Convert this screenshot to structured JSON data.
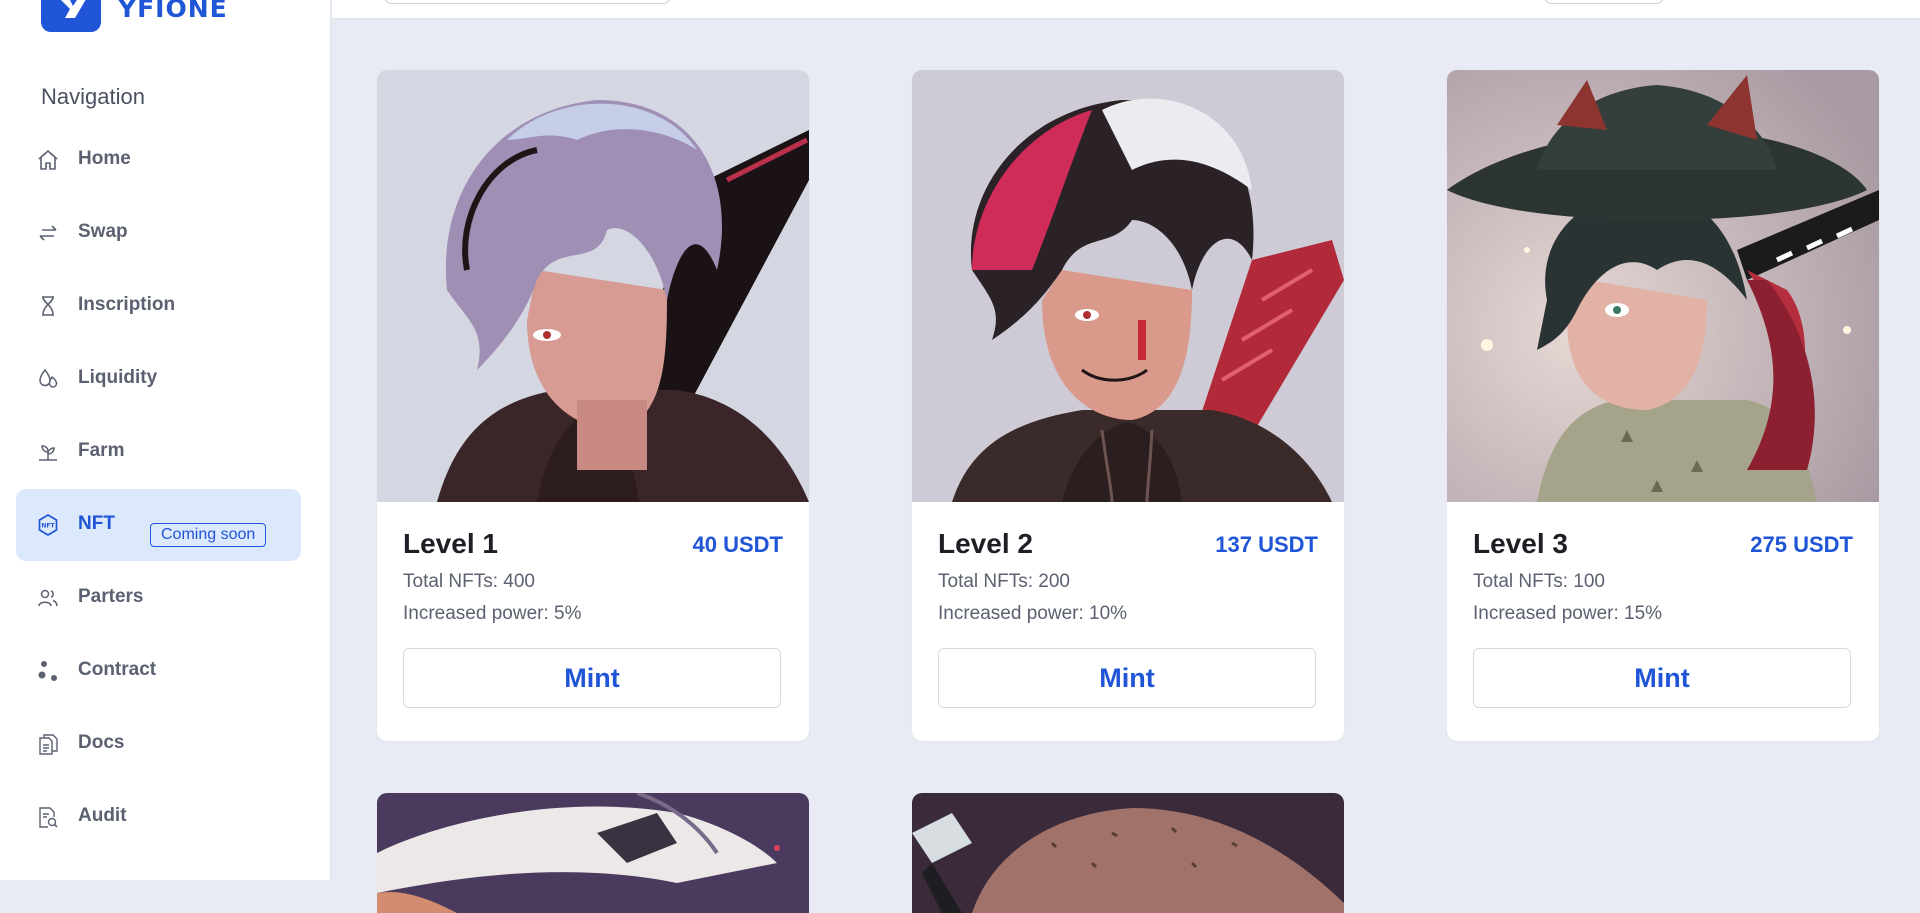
{
  "brand": {
    "name": "YFIONE",
    "color": "#1f55d6"
  },
  "sidebar": {
    "heading": "Navigation",
    "items": [
      {
        "label": "Home",
        "icon": "home-icon"
      },
      {
        "label": "Swap",
        "icon": "swap-icon"
      },
      {
        "label": "Inscription",
        "icon": "hourglass-icon"
      },
      {
        "label": "Liquidity",
        "icon": "liquidity-icon"
      },
      {
        "label": "Farm",
        "icon": "farm-icon"
      },
      {
        "label": "NFT",
        "icon": "nft-icon",
        "active": true,
        "badge": "Coming soon"
      },
      {
        "label": "Parters",
        "icon": "users-icon"
      },
      {
        "label": "Contract",
        "icon": "contract-icon"
      },
      {
        "label": "Docs",
        "icon": "docs-icon"
      },
      {
        "label": "Audit",
        "icon": "audit-icon"
      }
    ]
  },
  "cards": [
    {
      "title": "Level 1",
      "price": "40 USDT",
      "total": "Total NFTs: 400",
      "power": "Increased power: 5%",
      "button": "Mint",
      "image": "anime-character-level-1"
    },
    {
      "title": "Level 2",
      "price": "137 USDT",
      "total": "Total NFTs: 200",
      "power": "Increased power: 10%",
      "button": "Mint",
      "image": "anime-character-level-2"
    },
    {
      "title": "Level 3",
      "price": "275 USDT",
      "total": "Total NFTs: 100",
      "power": "Increased power: 15%",
      "button": "Mint",
      "image": "anime-character-level-3"
    }
  ],
  "colors": {
    "accent": "#1f55d6",
    "background": "#e8ebf4",
    "active_nav": "#dce8fb"
  }
}
